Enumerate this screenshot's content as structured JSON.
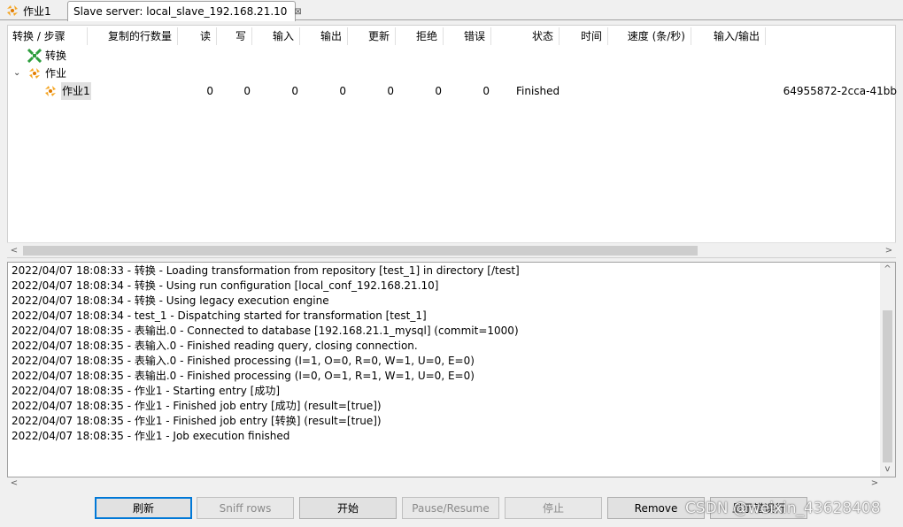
{
  "tabs": [
    {
      "label": "作业1",
      "icon": "job-icon",
      "active": false
    },
    {
      "label": "Slave server: local_slave_192.168.21.10",
      "close": "⊠",
      "active": true
    }
  ],
  "grid": {
    "headers": [
      "转换 / 步骤",
      "复制的行数量",
      "读",
      "写",
      "输入",
      "输出",
      "更新",
      "拒绝",
      "错误",
      "状态",
      "时间",
      "速度 (条/秒)",
      "输入/输出"
    ],
    "tree": {
      "transformations_label": "转换",
      "jobs_label": "作业",
      "expander": "⌄",
      "job_row": {
        "name": "作业1",
        "read": "0",
        "write": "0",
        "input": "0",
        "output": "0",
        "update": "0",
        "reject": "0",
        "error": "0",
        "status": "Finished",
        "id": "64955872-2cca-41bb"
      }
    }
  },
  "log": {
    "lines": [
      "2022/04/07 18:08:33 - 转换 - Loading transformation from repository [test_1] in directory [/test]",
      "2022/04/07 18:08:34 - 转换 - Using run configuration [local_conf_192.168.21.10]",
      "2022/04/07 18:08:34 - 转换 - Using legacy execution engine",
      "2022/04/07 18:08:34 - test_1 - Dispatching started for transformation [test_1]",
      "2022/04/07 18:08:35 - 表输出.0 - Connected to database [192.168.21.1_mysql] (commit=1000)",
      "2022/04/07 18:08:35 - 表输入.0 - Finished reading query, closing connection.",
      "2022/04/07 18:08:35 - 表输入.0 - Finished processing (I=1, O=0, R=0, W=1, U=0, E=0)",
      "2022/04/07 18:08:35 - 表输出.0 - Finished processing (I=0, O=1, R=1, W=1, U=0, E=0)",
      "2022/04/07 18:08:35 - 作业1 - Starting entry [成功]",
      "2022/04/07 18:08:35 - 作业1 - Finished job entry [成功] (result=[true])",
      "2022/04/07 18:08:35 - 作业1 - Finished job entry [转换] (result=[true])",
      "2022/04/07 18:08:35 - 作业1 - Job execution finished"
    ]
  },
  "scroll_arrows": {
    "left": "<",
    "right": ">",
    "up": "^",
    "down": "v"
  },
  "buttons": [
    {
      "label": "刷新",
      "enabled": true,
      "focused": true
    },
    {
      "label": "Sniff rows",
      "enabled": false
    },
    {
      "label": "开始",
      "enabled": true
    },
    {
      "label": "Pause/Resume",
      "enabled": false
    },
    {
      "label": "停止",
      "enabled": false
    },
    {
      "label": "Remove",
      "enabled": true
    },
    {
      "label": "显示错误行",
      "enabled": true
    }
  ],
  "watermark": "CSDN @weixin_43628408",
  "colors": {
    "accent": "#0078d7",
    "job_icon": "#f5a623",
    "trans_icon": "#2e9e3e"
  }
}
